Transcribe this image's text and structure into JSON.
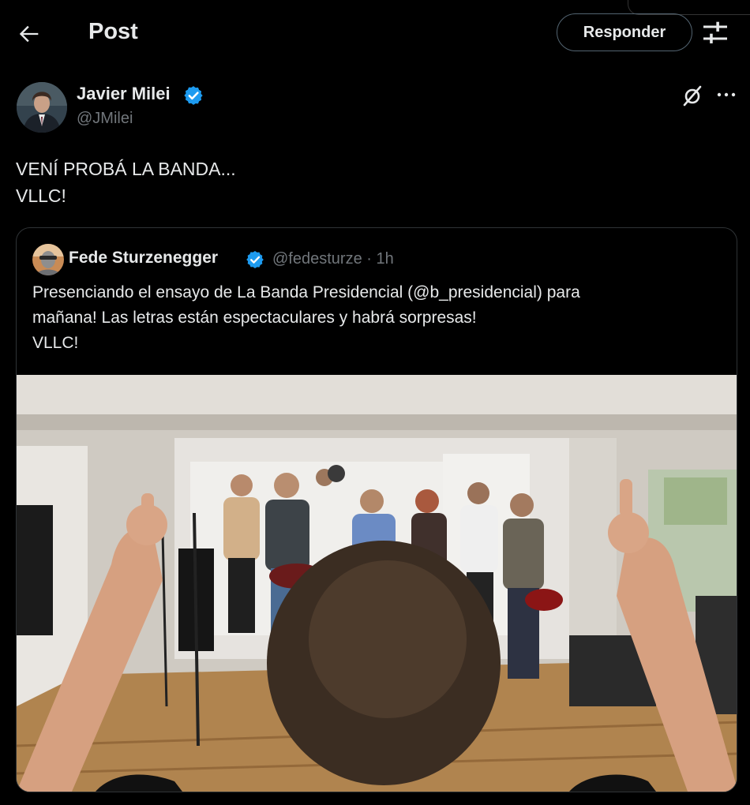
{
  "header": {
    "title": "Post",
    "reply_label": "Responder"
  },
  "post": {
    "author": {
      "name": "Javier Milei",
      "handle": "@JMilei"
    },
    "text_lines": [
      "VENÍ PROBÁ LA BANDA...",
      "VLLC!"
    ],
    "quoted": {
      "author": {
        "name": "Fede Sturzenegger",
        "handle": "@fedesturze",
        "separator": "·",
        "time": "1h"
      },
      "text_lines": [
        "Presenciando el ensayo de La Banda Presidencial (@b_presidencial) para",
        "mañana! Las letras están espectaculares y habrá sorpresas!",
        "VLLC!"
      ]
    }
  },
  "colors": {
    "background": "#000000",
    "text": "#e7e9ea",
    "muted": "#71767b",
    "border": "#2f3336",
    "verified": "#1d9bf0"
  },
  "icons": {
    "back": "arrow-left-icon",
    "tune": "sliders-icon",
    "verified": "verified-badge-icon",
    "grok": "grok-icon",
    "more": "more-horizontal-icon"
  }
}
